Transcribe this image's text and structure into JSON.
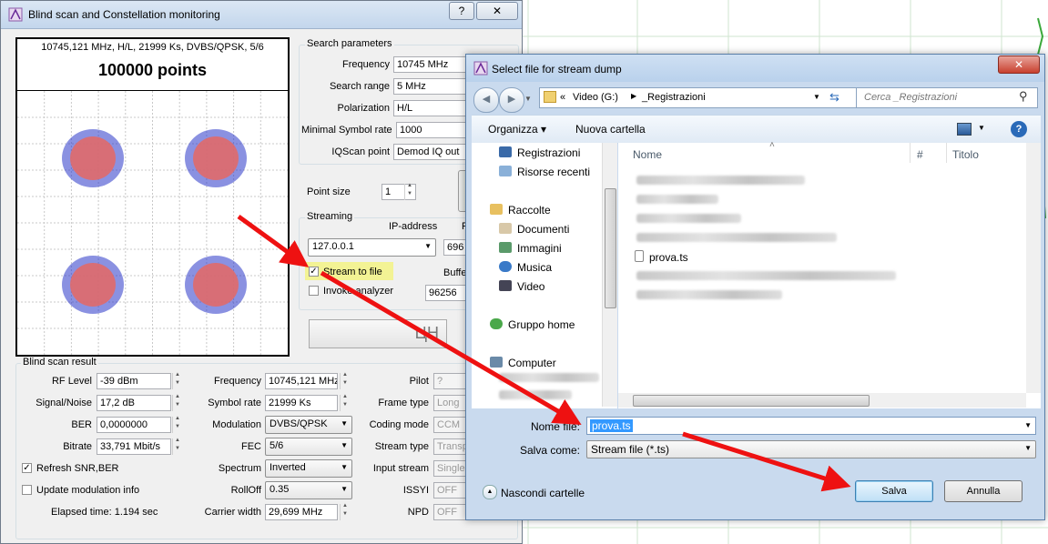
{
  "main": {
    "title": "Blind scan and Constellation monitoring",
    "window_help": "?",
    "window_close": "✕",
    "cons_header": "10745,121 MHz, H/L, 21999 Ks, DVBS/QPSK, 5/6",
    "cons_points": "100000 points",
    "search": {
      "group": "Search parameters",
      "frequency_label": "Frequency",
      "frequency_value": "10745 MHz",
      "range_label": "Search range",
      "range_value": "5 MHz",
      "pol_label": "Polarization",
      "pol_value": "H/L",
      "minsr_label": "Minimal Symbol rate",
      "minsr_value": "1000",
      "iq_label": "IQScan point",
      "iq_value": "Demod IQ out"
    },
    "pointsize_label": "Point size",
    "pointsize_value": "1",
    "streaming": {
      "group": "Streaming",
      "ip_label": "IP-address",
      "ip_value": "127.0.0.1",
      "port_partial": "696",
      "port_header_partial": "P",
      "stream_to_file": "Stream to file",
      "invoke_analyzer": "Invoke analyzer",
      "buffer_label": "Buffe",
      "buffer_value": "96256"
    },
    "result": {
      "group": "Blind scan result",
      "rf_label": "RF Level",
      "rf_value": "-39 dBm",
      "snr_label": "Signal/Noise",
      "snr_value": "17,2 dB",
      "ber_label": "BER",
      "ber_value": "0,0000000",
      "bitrate_label": "Bitrate",
      "bitrate_value": "33,791 Mbit/s",
      "refresh_label": "Refresh SNR,BER",
      "update_label": "Update modulation info",
      "elapsed": "Elapsed time: 1.194 sec",
      "freq_label": "Frequency",
      "freq_value": "10745,121 MHz",
      "sr_label": "Symbol rate",
      "sr_value": "21999 Ks",
      "mod_label": "Modulation",
      "mod_value": "DVBS/QPSK",
      "fec_label": "FEC",
      "fec_value": "5/6",
      "spectrum_label": "Spectrum",
      "spectrum_value": "Inverted",
      "rolloff_label": "RollOff",
      "rolloff_value": "0.35",
      "cw_label": "Carrier width",
      "cw_value": "29,699 MHz",
      "pilot_label": "Pilot",
      "pilot_value": "?",
      "frametype_label": "Frame type",
      "frametype_value": "Long",
      "coding_label": "Coding mode",
      "coding_value": "CCM",
      "streamtype_label": "Stream type",
      "streamtype_value": "Transp",
      "input_label": "Input stream",
      "input_value": "Single",
      "issyi_label": "ISSYI",
      "issyi_value": "OFF",
      "npd_label": "NPD",
      "npd_value": "OFF"
    }
  },
  "dialog": {
    "title": "Select file for stream dump",
    "close": "✕",
    "breadcrumb": [
      "«",
      "Video (G:)",
      "_Registrazioni"
    ],
    "search_placeholder": "Cerca _Registrazioni",
    "organize": "Organizza",
    "new_folder": "Nuova cartella",
    "help": "?",
    "nav": {
      "fav1": "Registrazioni",
      "fav2": "Risorse recenti",
      "libraries": "Raccolte",
      "docs": "Documenti",
      "images": "Immagini",
      "music": "Musica",
      "video": "Video",
      "homegroup": "Gruppo home",
      "computer": "Computer"
    },
    "columns": {
      "name": "Nome",
      "num": "#",
      "title": "Titolo"
    },
    "file_visible": "prova.ts",
    "filename_label": "Nome file:",
    "filename_value": "prova.ts",
    "saveas_label": "Salva come:",
    "saveas_value": "Stream file (*.ts)",
    "hide_folders": "Nascondi cartelle",
    "save": "Salva",
    "cancel": "Annulla"
  },
  "colors": {
    "arrow": "#ee1111",
    "highlight": "#f3f394",
    "cluster_outer": "#2a36c8",
    "cluster_inner": "#e06a6a"
  }
}
